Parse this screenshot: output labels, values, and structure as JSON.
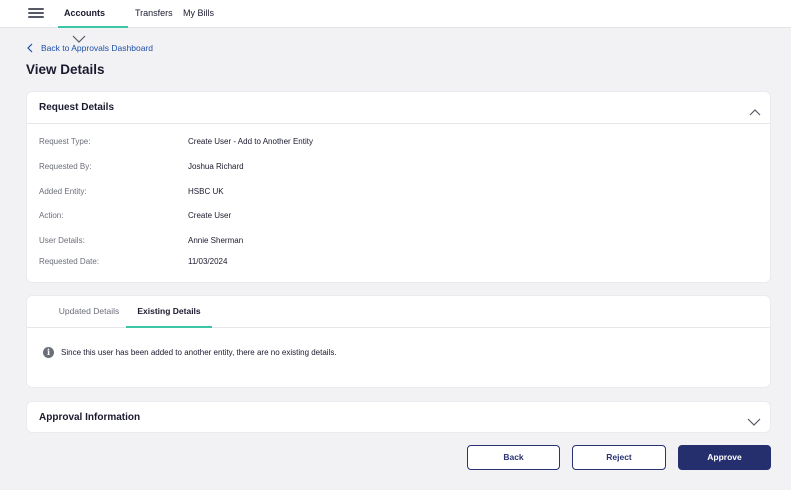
{
  "nav": {
    "items": [
      {
        "label": "Accounts"
      },
      {
        "label": "Transfers"
      },
      {
        "label": "My Bills"
      }
    ]
  },
  "back_link": "Back to Approvals Dashboard",
  "page_title": "View Details",
  "request_details": {
    "title": "Request Details",
    "rows": [
      {
        "label": "Request Type:",
        "value": "Create User - Add to Another Entity"
      },
      {
        "label": "Requested By:",
        "value": "Joshua Richard"
      },
      {
        "label": "Added Entity:",
        "value": "HSBC UK"
      },
      {
        "label": "Action:",
        "value": "Create User"
      },
      {
        "label": "User Details:",
        "value": "Annie Sherman"
      },
      {
        "label": "Requested Date:",
        "value": "11/03/2024"
      }
    ]
  },
  "tabs": {
    "items": [
      {
        "label": "Updated Details"
      },
      {
        "label": "Existing Details"
      }
    ],
    "message": "Since this user has been added to another entity, there are no existing details."
  },
  "approval_information": {
    "title": "Approval Information"
  },
  "actions": {
    "back": "Back",
    "reject": "Reject",
    "approve": "Approve"
  },
  "colors": {
    "accent": "#3cc6a8",
    "primary": "#262f6e",
    "link": "#1d4fa8"
  }
}
